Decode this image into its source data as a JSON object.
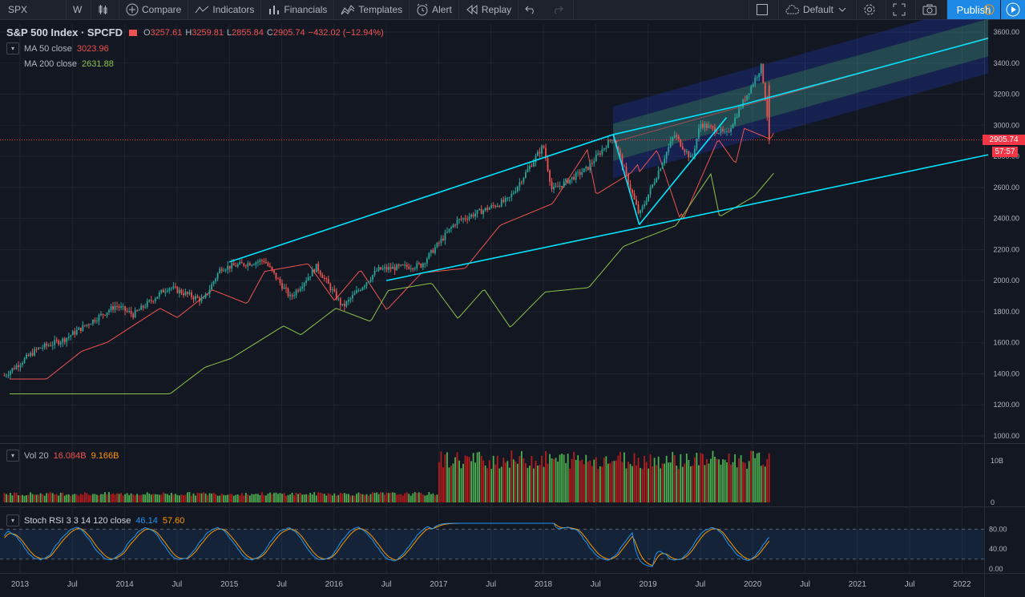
{
  "toolbar": {
    "symbol": "SPX",
    "interval": "W",
    "compare": "Compare",
    "indicators": "Indicators",
    "financials": "Financials",
    "templates": "Templates",
    "alert": "Alert",
    "replay": "Replay",
    "layout": "Default",
    "publish": "Publish"
  },
  "legend": {
    "title": "S&P 500 Index · SPCFD",
    "o_label": "O",
    "o": "3257.61",
    "h_label": "H",
    "h": "3259.81",
    "l_label": "L",
    "l": "2855.84",
    "c_label": "C",
    "c": "2905.74",
    "change": "−432.02 (−12.94%)",
    "ma50_label": "MA 50 close",
    "ma50": "3023.96",
    "ma200_label": "MA 200 close",
    "ma200": "2631.88"
  },
  "volume_legend": {
    "label": "Vol 20",
    "v1": "16.084B",
    "v2": "9.166B"
  },
  "stoch_legend": {
    "label": "Stoch RSI 3 3 14 120 close",
    "k": "46.14",
    "d": "57.60"
  },
  "price_labels": {
    "last": "2905.74",
    "countdown": "57:57"
  },
  "colors": {
    "up": "#26a69a",
    "down": "#ef5350",
    "ma50": "#ef5350",
    "ma200": "#8bc34a",
    "trend": "#00e5ff",
    "accent": "#1e88e5"
  },
  "chart_data": [
    {
      "type": "candlestick",
      "title": "S&P 500 Index · SPCFD",
      "interval": "W",
      "y_ticks": [
        1000,
        1200,
        1400,
        1600,
        1800,
        2000,
        2200,
        2400,
        2600,
        2800,
        3000,
        3200,
        3400,
        3600
      ],
      "x_ticks": [
        "2013",
        "Jul",
        "2014",
        "Jul",
        "2015",
        "Jul",
        "2016",
        "Jul",
        "2017",
        "Jul",
        "2018",
        "Jul",
        "2019",
        "Jul",
        "2020",
        "Jul",
        "2021",
        "Jul",
        "2022"
      ],
      "ylim": [
        1000,
        3600
      ],
      "xlim": [
        "2012-11",
        "2022-04"
      ],
      "close_path": [
        {
          "date": "2012-11",
          "value": 1380
        },
        {
          "date": "2013-03",
          "value": 1560
        },
        {
          "date": "2013-06",
          "value": 1620
        },
        {
          "date": "2013-12",
          "value": 1840
        },
        {
          "date": "2014-02",
          "value": 1780
        },
        {
          "date": "2014-06",
          "value": 1960
        },
        {
          "date": "2014-10",
          "value": 1870
        },
        {
          "date": "2014-12",
          "value": 2080
        },
        {
          "date": "2015-05",
          "value": 2130
        },
        {
          "date": "2015-08",
          "value": 1890
        },
        {
          "date": "2015-11",
          "value": 2090
        },
        {
          "date": "2016-02",
          "value": 1830
        },
        {
          "date": "2016-06",
          "value": 2070
        },
        {
          "date": "2016-11",
          "value": 2100
        },
        {
          "date": "2017-03",
          "value": 2380
        },
        {
          "date": "2017-09",
          "value": 2520
        },
        {
          "date": "2018-01",
          "value": 2870
        },
        {
          "date": "2018-02",
          "value": 2580
        },
        {
          "date": "2018-06",
          "value": 2720
        },
        {
          "date": "2018-09",
          "value": 2930
        },
        {
          "date": "2018-12",
          "value": 2420
        },
        {
          "date": "2019-04",
          "value": 2940
        },
        {
          "date": "2019-06",
          "value": 2780
        },
        {
          "date": "2019-07",
          "value": 3010
        },
        {
          "date": "2019-10",
          "value": 2940
        },
        {
          "date": "2020-02",
          "value": 3380
        },
        {
          "date": "2020-03",
          "value": 2905.74
        }
      ],
      "ma50": {
        "name": "MA 50 close",
        "last": 3023.96
      },
      "ma200": {
        "name": "MA 200 close",
        "last": 2631.88
      },
      "last": 2905.74,
      "trend_lines": [
        {
          "from": {
            "date": "2015-01",
            "value": 2120
          },
          "to": {
            "date": "2018-09",
            "value": 2940
          }
        },
        {
          "from": {
            "date": "2016-07",
            "value": 2000
          },
          "to": {
            "date": "2022-04",
            "value": 2810
          }
        },
        {
          "from": {
            "date": "2018-09",
            "value": 2940
          },
          "to": {
            "date": "2019-11",
            "value": 3120
          }
        },
        {
          "from": {
            "date": "2018-12",
            "value": 2360
          },
          "to": {
            "date": "2019-10",
            "value": 3050
          }
        },
        {
          "from": {
            "date": "2018-09",
            "value": 2940
          },
          "to": {
            "date": "2018-12",
            "value": 2360
          }
        },
        {
          "from": {
            "date": "2019-11",
            "value": 3120
          },
          "to": {
            "date": "2022-04",
            "value": 3560
          }
        }
      ]
    },
    {
      "type": "bar",
      "title": "Vol 20",
      "y_ticks": [
        "0",
        "10B"
      ],
      "values_info": {
        "v1": "16.084B",
        "v2": "9.166B"
      }
    },
    {
      "type": "line",
      "title": "Stoch RSI 3 3 14 120 close",
      "y_ticks": [
        "0.00",
        "40.00",
        "80.00"
      ],
      "ylim": [
        0,
        100
      ],
      "series": [
        {
          "name": "K",
          "last": 46.14
        },
        {
          "name": "D",
          "last": 57.6
        }
      ],
      "bands": [
        20,
        80
      ]
    }
  ]
}
